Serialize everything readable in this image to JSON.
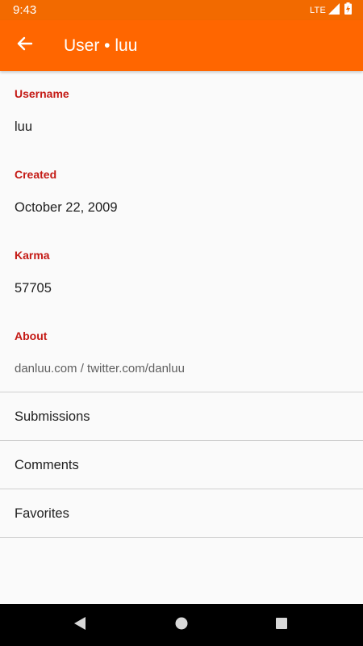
{
  "status_bar": {
    "time": "9:43",
    "network": "LTE"
  },
  "app_bar": {
    "title": "User • luu",
    "back_icon": "arrow-back-icon"
  },
  "profile": {
    "username_label": "Username",
    "username_value": "luu",
    "created_label": "Created",
    "created_value": "October 22, 2009",
    "karma_label": "Karma",
    "karma_value": "57705",
    "about_label": "About",
    "about_value": "danluu.com / twitter.com/danluu"
  },
  "menu": {
    "items": [
      {
        "label": "Submissions"
      },
      {
        "label": "Comments"
      },
      {
        "label": "Favorites"
      }
    ]
  },
  "nav": {
    "back_icon": "triangle-back-icon",
    "home_icon": "circle-home-icon",
    "recents_icon": "square-recents-icon"
  },
  "colors": {
    "app_bar": "#ff6600",
    "status_bar": "#f26a00",
    "label": "#c41a15",
    "divider": "#d0d0d0"
  }
}
